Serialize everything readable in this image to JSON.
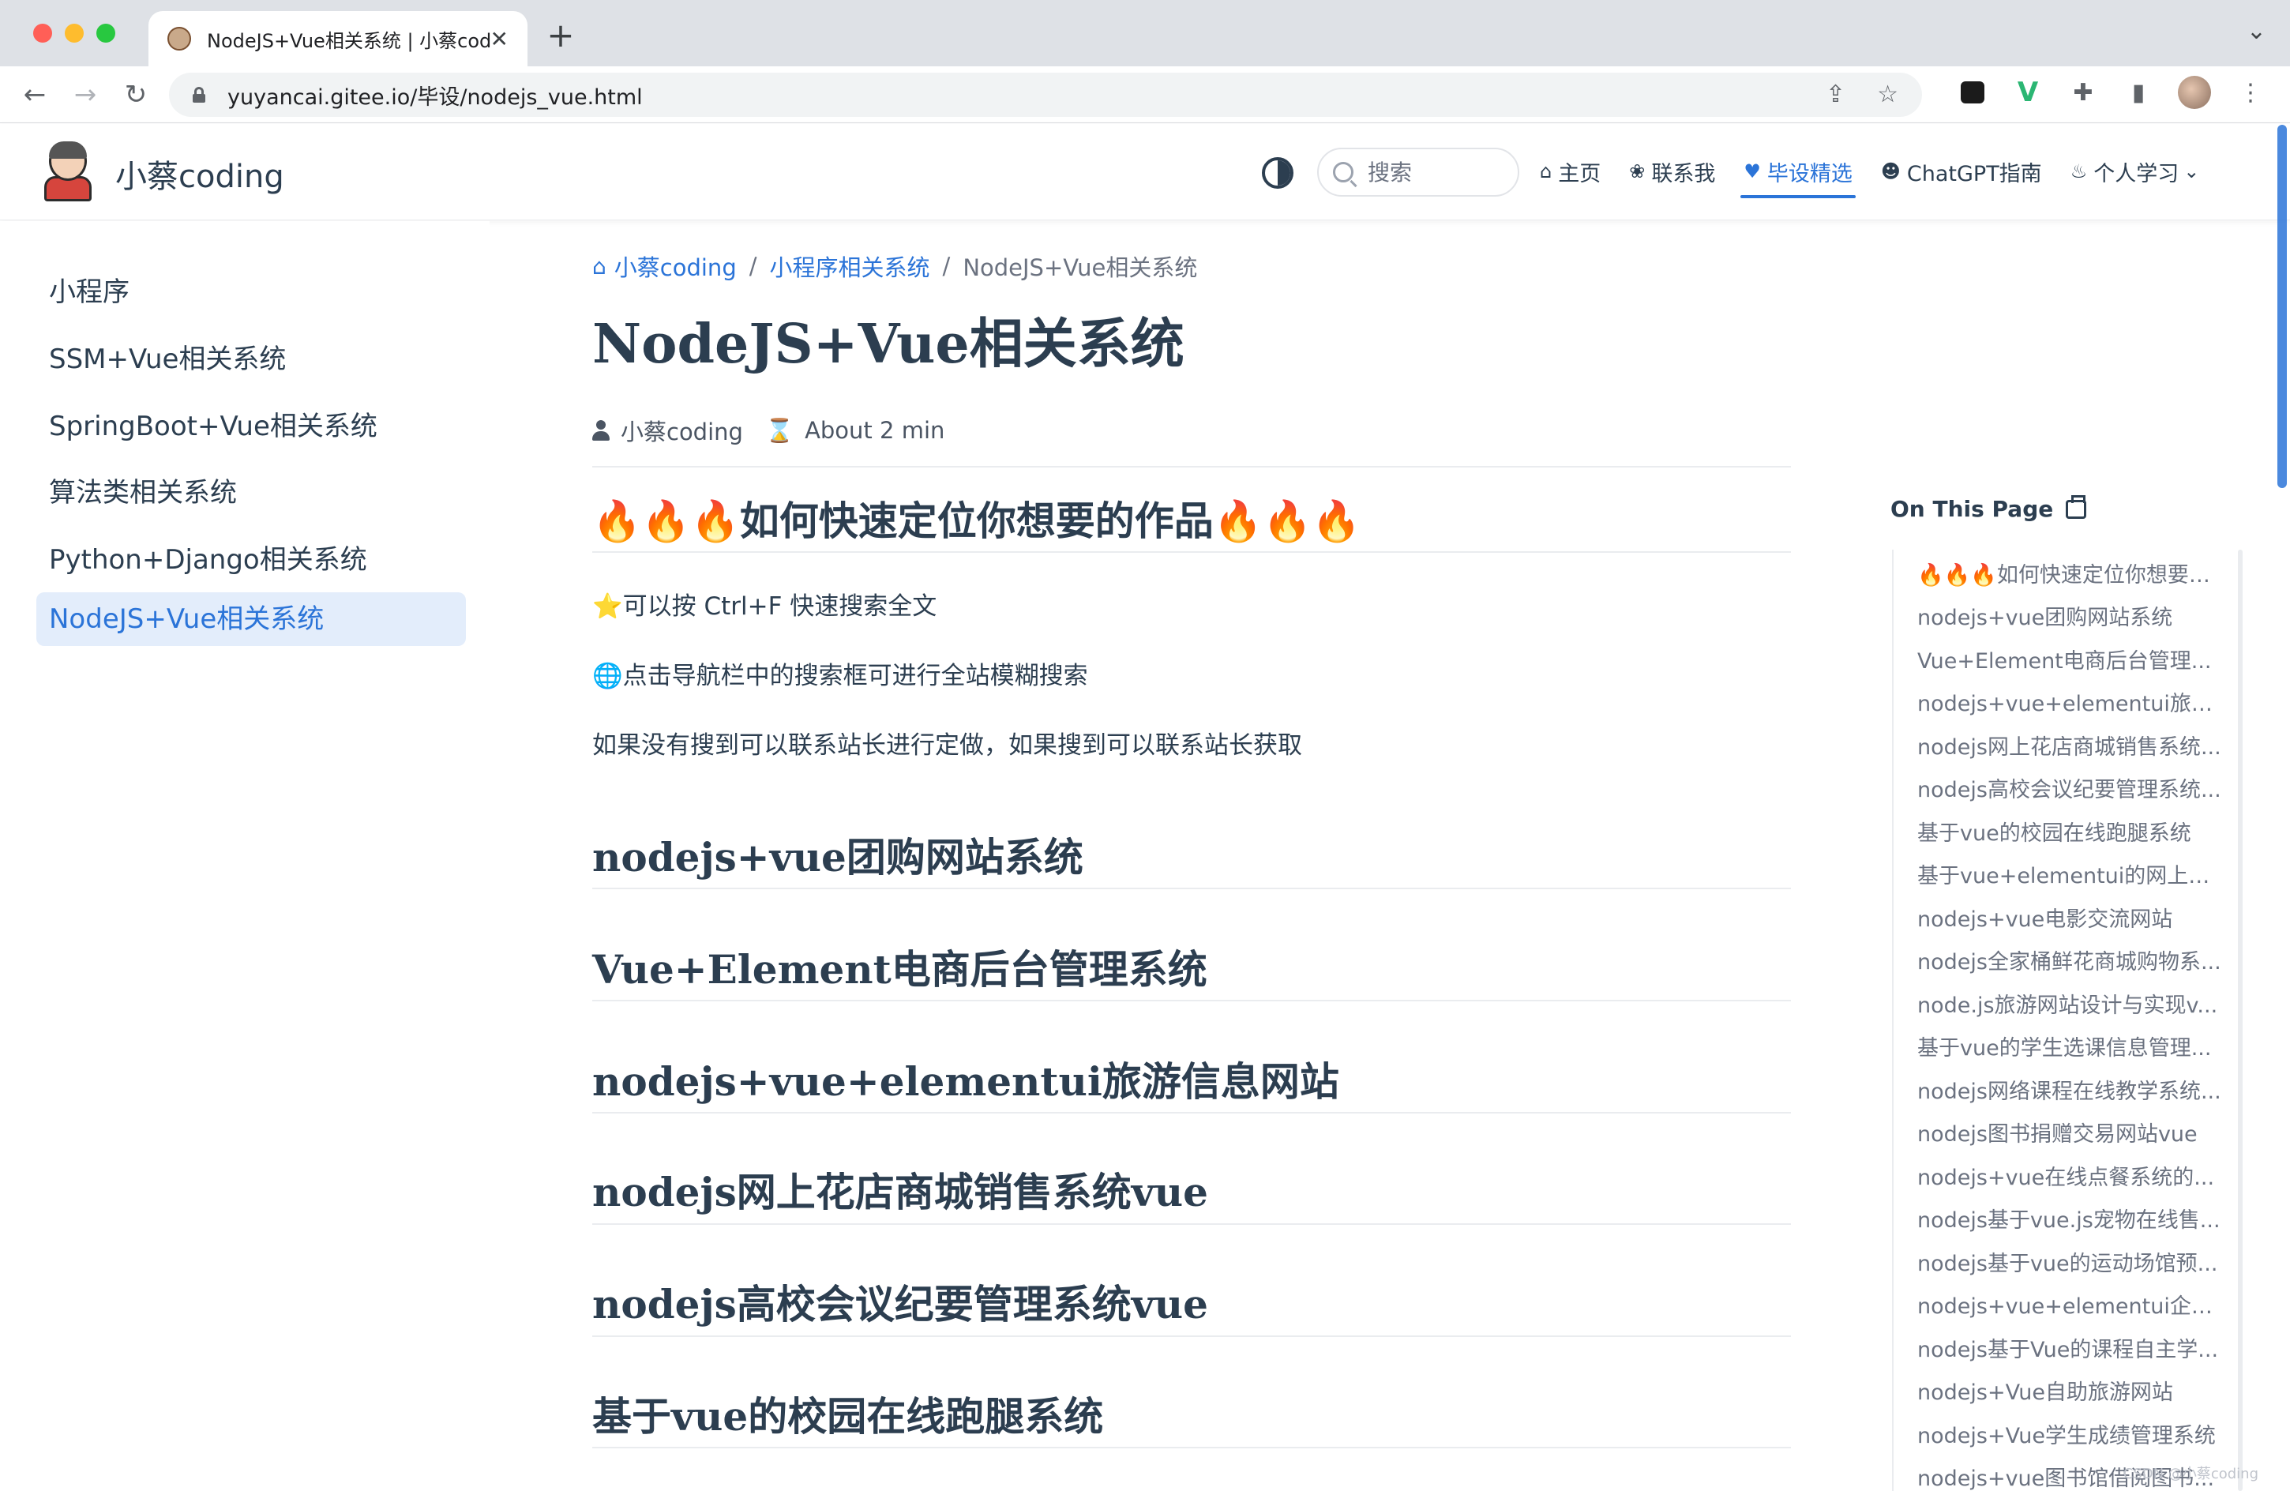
{
  "browser": {
    "tab_title": "NodeJS+Vue相关系统 | 小蔡coding",
    "tab_close": "✕",
    "new_tab": "+",
    "tabs_menu": "⌄",
    "back": "←",
    "forward": "→",
    "reload": "↻",
    "url": "yuyancai.gitee.io/毕设/nodejs_vue.html",
    "share_icon": "⇪",
    "bookmark_icon": "☆",
    "puzzle_icon": "✚",
    "panel_icon": "▮",
    "menu_icon": "⋮"
  },
  "header": {
    "site_name": "小蔡coding",
    "search_placeholder": "搜索",
    "nav": [
      {
        "icon": "home-icon",
        "glyph": "⌂",
        "label": "主页"
      },
      {
        "icon": "wechat-icon",
        "glyph": "❀",
        "label": "联系我"
      },
      {
        "icon": "heart-icon",
        "glyph": "♥",
        "label": "毕设精选"
      },
      {
        "icon": "smile-icon",
        "glyph": "☻",
        "label": "ChatGPT指南"
      },
      {
        "icon": "fire-icon",
        "glyph": "♨",
        "label": "个人学习"
      }
    ],
    "dropdown_caret": "⌄"
  },
  "sidebar": {
    "items": [
      {
        "label": "小程序",
        "active": false
      },
      {
        "label": "SSM+Vue相关系统",
        "active": false
      },
      {
        "label": "SpringBoot+Vue相关系统",
        "active": false
      },
      {
        "label": "算法类相关系统",
        "active": false
      },
      {
        "label": "Python+Django相关系统",
        "active": false
      },
      {
        "label": "NodeJS+Vue相关系统",
        "active": true
      }
    ]
  },
  "main": {
    "breadcrumb": {
      "home_icon": "⌂",
      "items": [
        "小蔡coding",
        "小程序相关系统",
        "NodeJS+Vue相关系统"
      ],
      "separator": "/"
    },
    "title": "NodeJS+Vue相关系统",
    "meta": {
      "author": "小蔡coding",
      "reading_time_icon": "⌛",
      "reading_time": "About 2 min"
    },
    "intro_heading": "🔥🔥🔥如何快速定位你想要的作品🔥🔥🔥",
    "tips": [
      "⭐可以按 Ctrl+F 快速搜索全文",
      "🌐点击导航栏中的搜索框可进行全站模糊搜索",
      "如果没有搜到可以联系站长进行定做，如果搜到可以联系站长获取"
    ],
    "sections": [
      "nodejs+vue团购网站系统",
      "Vue+Element电商后台管理系统",
      "nodejs+vue+elementui旅游信息网站",
      "nodejs网上花店商城销售系统vue",
      "nodejs高校会议纪要管理系统vue",
      "基于vue的校园在线跑腿系统"
    ]
  },
  "toc": {
    "title": "On This Page",
    "items": [
      "🔥🔥🔥如何快速定位你想要的...",
      "nodejs+vue团购网站系统",
      "Vue+Element电商后台管理...",
      "nodejs+vue+elementui旅游...",
      "nodejs网上花店商城销售系统...",
      "nodejs高校会议纪要管理系统...",
      "基于vue的校园在线跑腿系统",
      "基于vue+elementui的网上书...",
      "nodejs+vue电影交流网站",
      "nodejs全家桶鲜花商城购物系...",
      "node.js旅游网站设计与实现v...",
      "基于vue的学生选课信息管理...",
      "nodejs网络课程在线教学系统...",
      "nodejs图书捐赠交易网站vue",
      "nodejs+vue在线点餐系统的...",
      "nodejs基于vue.js宠物在线售...",
      "nodejs基于vue的运动场馆预...",
      "nodejs+vue+elementui企业...",
      "nodejs基于Vue的课程自主学...",
      "nodejs+Vue自助旅游网站",
      "nodejs+Vue学生成绩管理系统",
      "nodejs+vue图书馆借阅图书..."
    ]
  },
  "watermark": "CSDN @小蔡coding"
}
